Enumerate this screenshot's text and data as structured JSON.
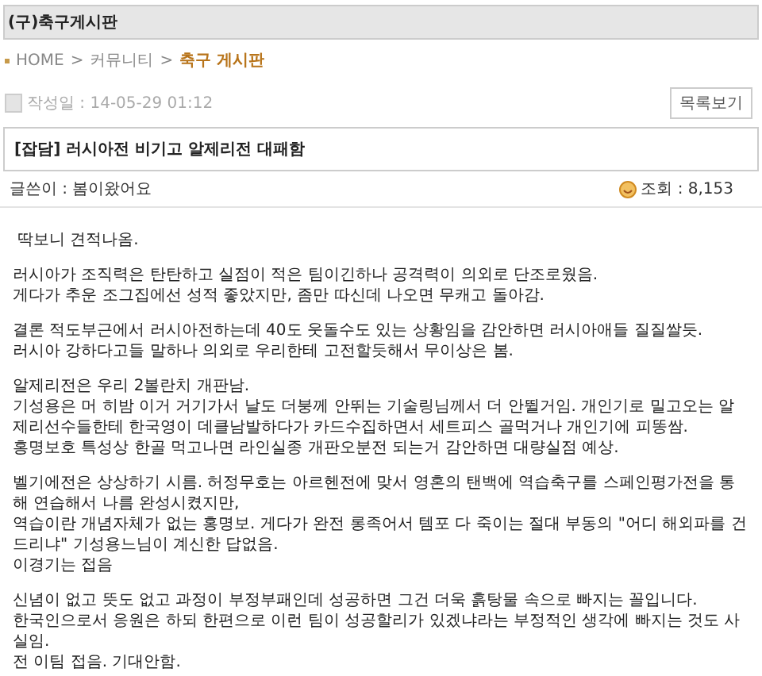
{
  "board_title": "(구)축구게시판",
  "breadcrumb": {
    "separator": ">",
    "items": [
      {
        "label": "HOME",
        "selected": false
      },
      {
        "label": "커뮤니티",
        "selected": false
      },
      {
        "label": "축구 게시판",
        "selected": true
      }
    ]
  },
  "post": {
    "date": "작성일 : 14-05-29 01:12",
    "list_button": "목록보기",
    "title": "[잡담] 러시아전 비기고 알제리전 대패함",
    "author": "글쓴이 : 봄이왔어요",
    "views": "조회 : 8,153",
    "paragraphs": [
      [
        "딱보니 견적나옴."
      ],
      [
        "러시아가 조직력은 탄탄하고 실점이 적은 팀이긴하나 공격력이 의외로 단조로웠음.",
        "게다가 추운 조그집에선 성적 좋았지만, 좀만 따신데 나오면 무캐고 돌아감."
      ],
      [
        "결론 적도부근에서 러시아전하는데 40도 웃돌수도 있는 상황임을 감안하면 러시아애들 질질쌀듯.",
        "러시아 강하다고들 말하나 의외로 우리한테 고전할듯해서 무이상은 봄."
      ],
      [
        "알제리전은 우리 2볼란치 개판남.",
        "기성용은 머 히밤 이거  거기가서 날도 더붕께 안뛰는 기술링님께서  더 안뛸거임. 개인기로 밀고오는 알제리선수들한테 한국영이 데클남발하다가 카드수집하면서 세트피스 골먹거나 개인기에 피똥쌈.",
        "홍명보호 특성상 한골 먹고나면 라인실종 개판오분전 되는거 감안하면 대량실점 예상."
      ],
      [
        "벨기에전은 상상하기 시름. 허정무호는 아르헨전에 맞서 영혼의 탠백에 역습축구를 스페인평가전을 통해 연습해서 나름 완성시켰지만,",
        "역습이란 개념자체가 없는 홍명보. 게다가 완전 롱족어서 템포 다 죽이는 절대 부동의 \"어디 해외파를 건드리냐\" 기성용느님이 계신한 답없음.",
        "이경기는 접음"
      ],
      [
        "신념이 없고 뜻도 없고 과정이 부정부패인데 성공하면 그건 더욱 흙탕물 속으로 빠지는 꼴입니다.",
        "한국인으로서 응원은 하되 한편으로 이런 팀이 성공할리가 있겠냐라는 부정적인 생각에 빠지는 것도 사실임.",
        "전 이팀 접음. 기대안함."
      ]
    ]
  }
}
